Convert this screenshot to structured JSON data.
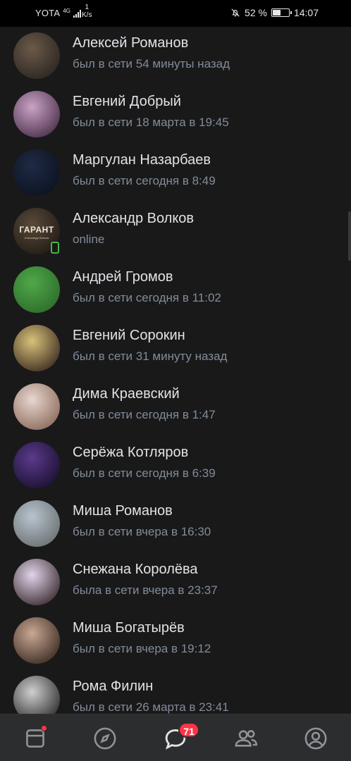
{
  "status_bar": {
    "carrier": "YOTA",
    "network_type": "4G",
    "speed_value": "1",
    "speed_unit": "K/s",
    "battery_percent": "52 %",
    "battery_level": 0.52,
    "time": "14:07"
  },
  "contacts": [
    {
      "name": "Алексей Романов",
      "status": "был в сети 54 минуты назад",
      "online": false,
      "avatar_colors": [
        "#6b5a4a",
        "#2a2520"
      ]
    },
    {
      "name": "Евгений Добрый",
      "status": "был в сети 18 марта в 19:45",
      "online": false,
      "avatar_colors": [
        "#c9a3c7",
        "#4a2f48"
      ]
    },
    {
      "name": "Маргулан Назарбаев",
      "status": "был в сети сегодня в 8:49",
      "online": false,
      "avatar_colors": [
        "#1f2a44",
        "#0c1220"
      ]
    },
    {
      "name": "Александр Волков",
      "status": "online",
      "online": true,
      "avatar_colors": [
        "#5a4a3a",
        "#201a14"
      ]
    },
    {
      "name": "Андрей Громов",
      "status": "был в сети сегодня в 11:02",
      "online": false,
      "avatar_colors": [
        "#4fa84a",
        "#2d6b2a"
      ]
    },
    {
      "name": "Евгений Сорокин",
      "status": "был в сети 31 минуту назад",
      "online": false,
      "avatar_colors": [
        "#d8c27a",
        "#3b2a20"
      ]
    },
    {
      "name": "Дима Краевский",
      "status": "был в сети сегодня в 1:47",
      "online": false,
      "avatar_colors": [
        "#e8d6cf",
        "#8a6a5a"
      ]
    },
    {
      "name": "Серёжа Котляров",
      "status": "был в сети сегодня в 6:39",
      "online": false,
      "avatar_colors": [
        "#5a3a8a",
        "#1a1030"
      ]
    },
    {
      "name": "Миша Романов",
      "status": "был в сети вчера в 16:30",
      "online": false,
      "avatar_colors": [
        "#b7c4cf",
        "#6a6f70"
      ]
    },
    {
      "name": "Снежана Королёва",
      "status": "была в сети вчера в 23:37",
      "online": false,
      "avatar_colors": [
        "#e0d4e8",
        "#3a2a30"
      ]
    },
    {
      "name": "Миша Богатырёв",
      "status": "был в сети вчера в 19:12",
      "online": false,
      "avatar_colors": [
        "#c8a893",
        "#3a2a22"
      ]
    },
    {
      "name": "Рома Филин",
      "status": "был в сети 26 марта в 23:41",
      "online": false,
      "avatar_colors": [
        "#cfcfcf",
        "#2a2a2a"
      ]
    }
  ],
  "avatar_overlay_text": {
    "index": 3,
    "title": "ГАРАНТ",
    "subtitle": "Александр Волков"
  },
  "tabbar": {
    "items": [
      {
        "name": "news",
        "icon": "newsfeed-icon",
        "has_dot": true
      },
      {
        "name": "discover",
        "icon": "compass-icon"
      },
      {
        "name": "messages",
        "icon": "chat-bubble-icon",
        "badge": "71"
      },
      {
        "name": "friends",
        "icon": "friends-icon"
      },
      {
        "name": "profile",
        "icon": "profile-icon"
      }
    ]
  },
  "colors": {
    "background": "#19191a",
    "tabbar": "#2c2d2e",
    "badge": "#ff3347",
    "online": "#4bb34b",
    "icon": "#909499"
  }
}
